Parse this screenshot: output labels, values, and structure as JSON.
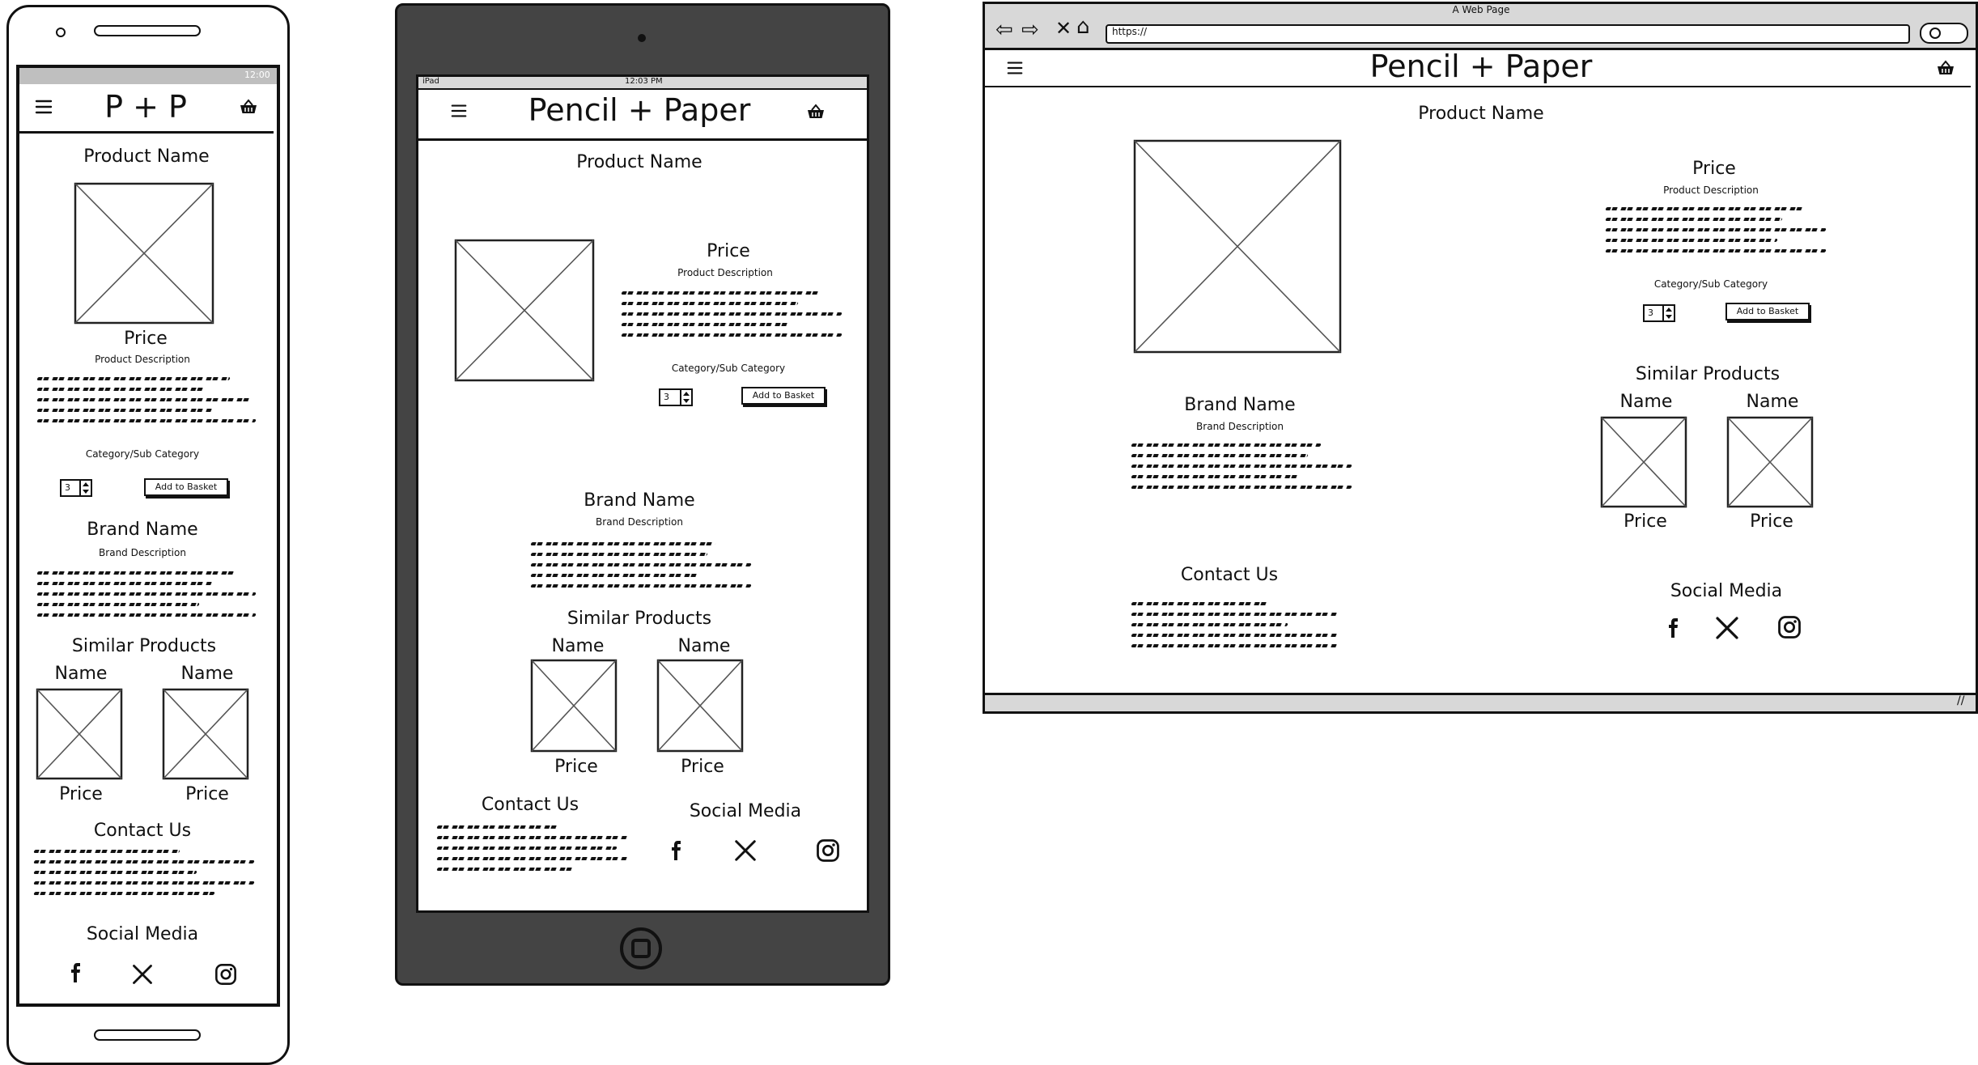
{
  "phone": {
    "status_time": "12:00",
    "header": {
      "title": "P + P"
    },
    "product_name": "Product Name",
    "price": "Price",
    "product_description": "Product Description",
    "category": "Category/Sub Category",
    "qty": "3",
    "add_to_basket": "Add to Basket",
    "brand_name": "Brand Name",
    "brand_description": "Brand Description",
    "similar_products": "Similar Products",
    "similar_items": [
      {
        "name": "Name",
        "price": "Price"
      },
      {
        "name": "Name",
        "price": "Price"
      }
    ],
    "contact_us": "Contact Us",
    "social_media": "Social Media"
  },
  "tablet": {
    "status_device": "iPad",
    "status_time": "12:03 PM",
    "header": {
      "title": "Pencil + Paper"
    },
    "product_name": "Product Name",
    "price": "Price",
    "product_description": "Product Description",
    "category": "Category/Sub Category",
    "qty": "3",
    "add_to_basket": "Add to Basket",
    "brand_name": "Brand Name",
    "brand_description": "Brand Description",
    "similar_products": "Similar Products",
    "similar_items": [
      {
        "name": "Name",
        "price": "Price"
      },
      {
        "name": "Name",
        "price": "Price"
      }
    ],
    "contact_us": "Contact Us",
    "social_media": "Social Media"
  },
  "browser": {
    "window_title": "A Web Page",
    "url": "https://",
    "header": {
      "title": "Pencil + Paper"
    },
    "product_name": "Product Name",
    "price": "Price",
    "product_description": "Product Description",
    "category": "Category/Sub Category",
    "qty": "3",
    "add_to_basket": "Add to Basket",
    "brand_name": "Brand Name",
    "brand_description": "Brand Description",
    "similar_products": "Similar Products",
    "similar_items": [
      {
        "name": "Name",
        "price": "Price"
      },
      {
        "name": "Name",
        "price": "Price"
      }
    ],
    "contact_us": "Contact Us",
    "social_media": "Social Media"
  },
  "icons": {
    "menu": "hamburger-menu-icon",
    "basket": "shopping-basket-icon",
    "facebook": "facebook-icon",
    "x": "x-twitter-icon",
    "instagram": "instagram-icon"
  },
  "colors": {
    "tablet_frame": "#444444",
    "browser_chrome": "#d8d8d8",
    "ink": "#111111"
  }
}
